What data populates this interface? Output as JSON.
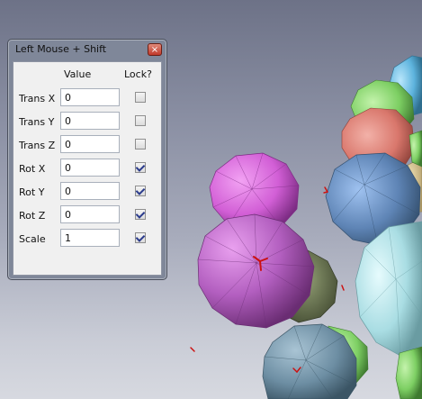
{
  "dialog": {
    "title": "Left Mouse + Shift",
    "close_glyph": "×",
    "headers": {
      "value": "Value",
      "lock": "Lock?"
    },
    "rows": [
      {
        "label": "Trans X",
        "value": "0",
        "locked": false
      },
      {
        "label": "Trans Y",
        "value": "0",
        "locked": false
      },
      {
        "label": "Trans Z",
        "value": "0",
        "locked": false
      },
      {
        "label": "Rot X",
        "value": "0",
        "locked": true
      },
      {
        "label": "Rot Y",
        "value": "0",
        "locked": true
      },
      {
        "label": "Rot Z",
        "value": "0",
        "locked": true
      },
      {
        "label": "Scale",
        "value": "1",
        "locked": true
      }
    ]
  },
  "colors": {
    "sphere_magenta": "#d25fd6",
    "sphere_purple": "#b35fc0",
    "sphere_olive": "#6f7a55",
    "sphere_steelblue": "#5e84b5",
    "sphere_cyan": "#a9dde3",
    "sphere_salmon": "#d9776c",
    "sphere_green": "#7dcf63",
    "sphere_skyblue": "#5db3dd",
    "sphere_slate": "#6d8ea3",
    "marker_red": "#cc1111"
  }
}
